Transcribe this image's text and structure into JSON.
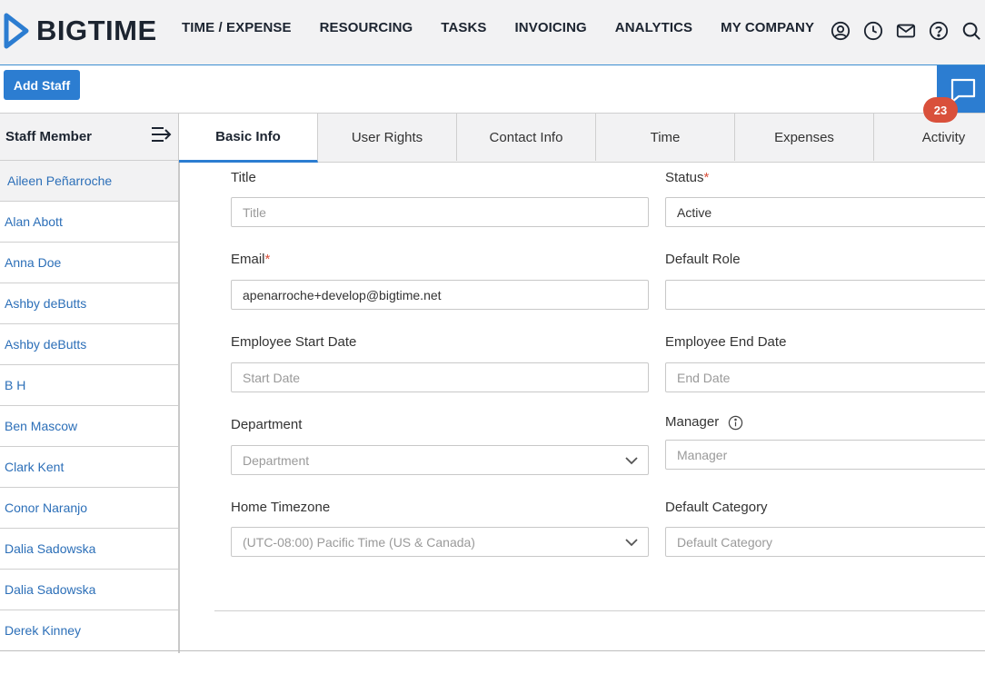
{
  "app": {
    "logo_text": "BIGTIME"
  },
  "nav": {
    "items": [
      "TIME / EXPENSE",
      "RESOURCING",
      "TASKS",
      "INVOICING",
      "ANALYTICS",
      "MY COMPANY"
    ],
    "icons": [
      "user-circle-icon",
      "clock-icon",
      "mail-icon",
      "help-icon",
      "search-icon"
    ]
  },
  "toolbar": {
    "add_staff_label": "Add Staff",
    "chat_badge": "23"
  },
  "sidebar": {
    "title": "Staff Member",
    "staff": [
      "Aileen Peñarroche",
      "Alan Abott",
      "Anna Doe",
      "Ashby deButts",
      "Ashby deButts",
      "B H",
      "Ben Mascow",
      "Clark Kent",
      "Conor Naranjo",
      "Dalia Sadowska",
      "Dalia Sadowska",
      "Derek Kinney"
    ]
  },
  "tabs": [
    "Basic Info",
    "User Rights",
    "Contact Info",
    "Time",
    "Expenses",
    "Activity"
  ],
  "form": {
    "title_label": "Title",
    "title_placeholder": "Title",
    "status_label": "Status",
    "status_value": "Active",
    "email_label": "Email",
    "email_value": "apenarroche+develop@bigtime.net",
    "default_role_label": "Default Role",
    "default_role_value": "",
    "start_date_label": "Employee Start Date",
    "start_date_placeholder": "Start Date",
    "end_date_label": "Employee End Date",
    "end_date_placeholder": "End Date",
    "department_label": "Department",
    "department_placeholder": "Department",
    "manager_label": "Manager",
    "manager_placeholder": "Manager",
    "timezone_label": "Home Timezone",
    "timezone_value": "(UTC-08:00) Pacific Time (US & Canada)",
    "default_category_label": "Default Category",
    "default_category_placeholder": "Default Category",
    "required_mark": "*"
  },
  "colors": {
    "accent": "#2c7dd1",
    "link": "#2c6fb8",
    "badge": "#d9503b"
  }
}
